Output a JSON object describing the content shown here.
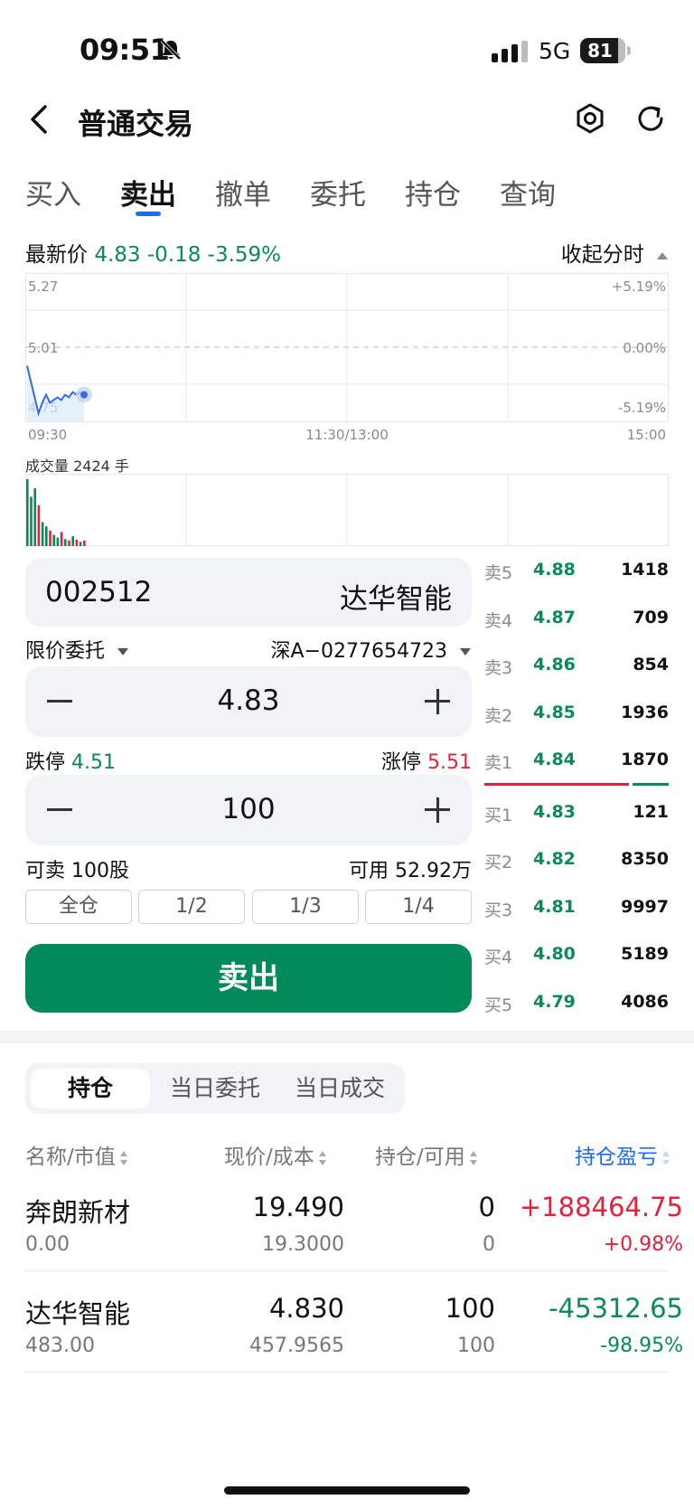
{
  "status_bar": {
    "time": "09:51",
    "network": "5G",
    "battery": "81"
  },
  "header": {
    "title": "普通交易"
  },
  "tabs": [
    {
      "label": "买入"
    },
    {
      "label": "卖出"
    },
    {
      "label": "撤单"
    },
    {
      "label": "委托"
    },
    {
      "label": "持仓"
    },
    {
      "label": "查询"
    }
  ],
  "quote": {
    "label": "最新价",
    "price": "4.83",
    "change": "-0.18",
    "change_pct": "-3.59%",
    "toggle_label": "收起分时"
  },
  "chart_data": {
    "type": "line",
    "y_left_ticks": [
      "5.27",
      "5.01",
      "4.75"
    ],
    "y_right_ticks": [
      "+5.19%",
      "0.00%",
      "-5.19%"
    ],
    "x_ticks": [
      "09:30",
      "11:30/13:00",
      "15:00"
    ],
    "ylim": [
      4.75,
      5.27
    ],
    "prev_close": 5.01,
    "price_series": [
      4.94,
      4.88,
      4.82,
      4.76,
      4.8,
      4.83,
      4.8,
      4.81,
      4.82,
      4.81,
      4.83,
      4.82,
      4.84,
      4.83,
      4.84,
      4.83
    ],
    "volume_label": "成交量 2424 手",
    "volume_series": [
      {
        "v": 95,
        "c": "green"
      },
      {
        "v": 70,
        "c": "green"
      },
      {
        "v": 82,
        "c": "green"
      },
      {
        "v": 58,
        "c": "red"
      },
      {
        "v": 34,
        "c": "green"
      },
      {
        "v": 28,
        "c": "green"
      },
      {
        "v": 22,
        "c": "red"
      },
      {
        "v": 16,
        "c": "green"
      },
      {
        "v": 12,
        "c": "green"
      },
      {
        "v": 20,
        "c": "red"
      },
      {
        "v": 10,
        "c": "green"
      },
      {
        "v": 8,
        "c": "red"
      },
      {
        "v": 14,
        "c": "green"
      },
      {
        "v": 9,
        "c": "red"
      },
      {
        "v": 6,
        "c": "green"
      },
      {
        "v": 8,
        "c": "red"
      }
    ]
  },
  "order": {
    "code": "002512",
    "name": "达华智能",
    "type": "限价委托",
    "account": "深A−0277654723",
    "price": "4.83",
    "limit_down_label": "跌停",
    "limit_down": "4.51",
    "limit_up_label": "涨停",
    "limit_up": "5.51",
    "quantity": "100",
    "sellable_label": "可卖",
    "sellable": "100股",
    "available_label": "可用",
    "available": "52.92万",
    "ratios": [
      "全仓",
      "1/2",
      "1/3",
      "1/4"
    ],
    "submit_label": "卖出"
  },
  "order_book": {
    "asks": [
      {
        "label": "卖5",
        "price": "4.88",
        "volume": "1418"
      },
      {
        "label": "卖4",
        "price": "4.87",
        "volume": "709"
      },
      {
        "label": "卖3",
        "price": "4.86",
        "volume": "854"
      },
      {
        "label": "卖2",
        "price": "4.85",
        "volume": "1936"
      },
      {
        "label": "卖1",
        "price": "4.84",
        "volume": "1870"
      }
    ],
    "bids": [
      {
        "label": "买1",
        "price": "4.83",
        "volume": "121"
      },
      {
        "label": "买2",
        "price": "4.82",
        "volume": "8350"
      },
      {
        "label": "买3",
        "price": "4.81",
        "volume": "9997"
      },
      {
        "label": "买4",
        "price": "4.80",
        "volume": "5189"
      },
      {
        "label": "买5",
        "price": "4.79",
        "volume": "4086"
      }
    ]
  },
  "holdings": {
    "segments": [
      "持仓",
      "当日委托",
      "当日成交"
    ],
    "columns": [
      "名称/市值",
      "现价/成本",
      "持仓/可用",
      "持仓盈亏"
    ],
    "rows": [
      {
        "name": "奔朗新材",
        "market_value": "0.00",
        "price": "19.490",
        "cost": "19.3000",
        "position": "0",
        "available": "0",
        "pnl": "+188464.75",
        "pnl_pct": "+0.98%",
        "pnl_color": "#e0223b"
      },
      {
        "name": "达华智能",
        "market_value": "483.00",
        "price": "4.830",
        "cost": "457.9565",
        "position": "100",
        "available": "100",
        "pnl": "-45312.65",
        "pnl_pct": "-98.95%",
        "pnl_color": "#0a8a55"
      }
    ]
  },
  "colors": {
    "accent": "#1a6cf0",
    "up": "#e0223b",
    "down": "#0a8a55",
    "sell_button": "#028a58"
  }
}
